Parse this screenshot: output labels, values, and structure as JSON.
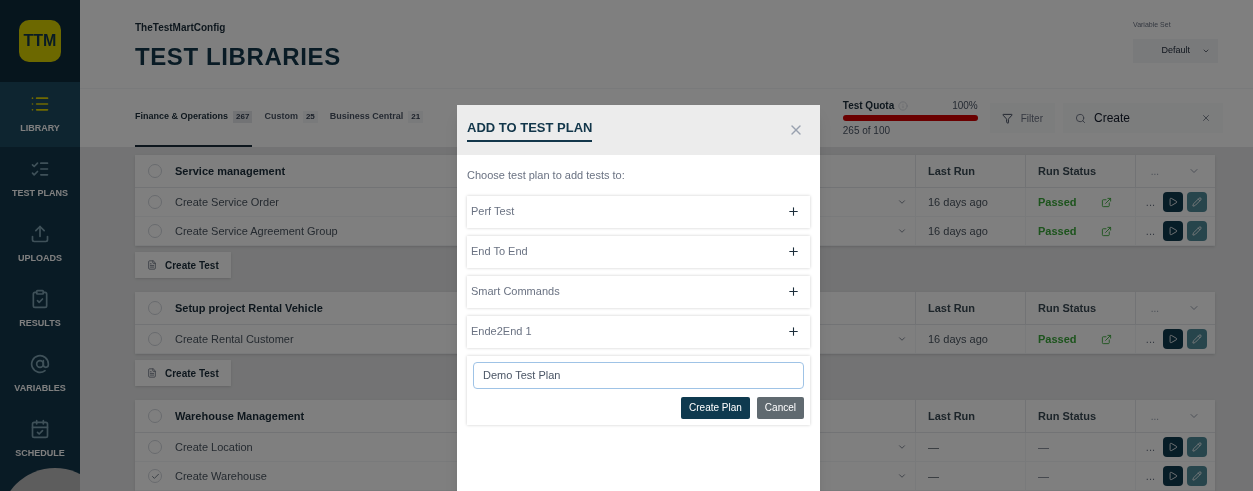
{
  "sidebar": {
    "logo": "TTM",
    "items": [
      {
        "label": "LIBRARY",
        "selected": true
      },
      {
        "label": "TEST PLANS",
        "selected": false
      },
      {
        "label": "UPLOADS",
        "selected": false
      },
      {
        "label": "RESULTS",
        "selected": false
      },
      {
        "label": "VARIABLES",
        "selected": false
      },
      {
        "label": "SCHEDULE",
        "selected": false
      }
    ]
  },
  "header": {
    "subtitle": "TheTestMartConfig",
    "title": "TEST LIBRARIES",
    "variable_set": {
      "label": "Variable Set",
      "value": "Default"
    }
  },
  "tabs": [
    {
      "label": "Finance & Operations",
      "count": "267",
      "selected": true
    },
    {
      "label": "Custom",
      "count": "25",
      "selected": false
    },
    {
      "label": "Business Central",
      "count": "21",
      "selected": false
    }
  ],
  "quota": {
    "label": "Test Quota",
    "percent": "100%",
    "level": 1,
    "count": "265 of 100"
  },
  "filter": {
    "label": "Filter"
  },
  "search": {
    "value": "Create"
  },
  "groups": [
    {
      "name": "Service management",
      "checked": false,
      "columns": [
        "Last Run",
        "Run Status"
      ],
      "more": "...",
      "create_button": "Create Test",
      "rows": [
        {
          "name": "Create Service Order",
          "checked": false,
          "last_run": "16 days ago",
          "status": {
            "text": "Passed",
            "kind": "passed"
          },
          "more": "..."
        },
        {
          "name": "Create Service Agreement Group",
          "checked": false,
          "last_run": "16 days ago",
          "status": {
            "text": "Passed",
            "kind": "passed"
          },
          "more": "..."
        }
      ]
    },
    {
      "name": "Setup project Rental Vehicle",
      "checked": false,
      "columns": [
        "Last Run",
        "Run Status"
      ],
      "more": "...",
      "create_button": "Create Test",
      "rows": [
        {
          "name": "Create Rental Customer",
          "checked": false,
          "last_run": "16 days ago",
          "status": {
            "text": "Passed",
            "kind": "passed"
          },
          "more": "..."
        }
      ]
    },
    {
      "name": "Warehouse Management",
      "checked": false,
      "columns": [
        "Last Run",
        "Run Status"
      ],
      "more": "...",
      "rows": [
        {
          "name": "Create Location",
          "checked": false,
          "last_run": "—",
          "status": {
            "text": "—",
            "kind": "none"
          },
          "more": "..."
        },
        {
          "name": "Create Warehouse",
          "checked": true,
          "last_run": "—",
          "status": {
            "text": "—",
            "kind": "none"
          },
          "more": "..."
        }
      ]
    }
  ],
  "modal": {
    "title": "ADD TO TEST PLAN",
    "prompt": "Choose test plan to add tests to:",
    "plans": [
      "Perf Test",
      "End To End",
      "Smart Commands",
      "Ende2End 1"
    ],
    "new_plan": {
      "value": "Demo Test Plan"
    },
    "buttons": [
      {
        "label": "Create Plan",
        "kind": "primary"
      },
      {
        "label": "Cancel",
        "kind": "secondary"
      }
    ]
  }
}
